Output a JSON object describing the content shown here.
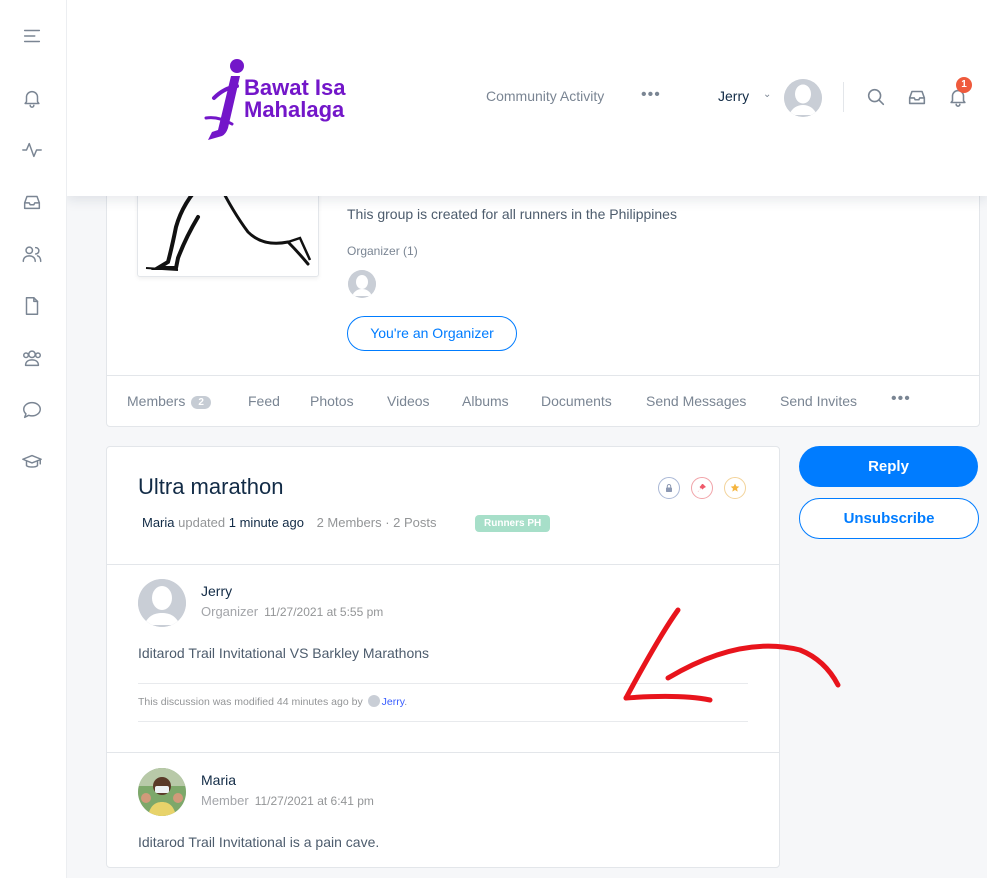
{
  "header": {
    "logo_line1": "Bawat Isa",
    "logo_line2": "Mahalaga",
    "nav_link": "Community Activity",
    "nav_more": "•••",
    "user_name": "Jerry",
    "user_chevron": "⌄",
    "notification_count": "1"
  },
  "sidebar": {
    "icons": [
      "menu-icon",
      "bell-icon",
      "activity-icon",
      "inbox-icon",
      "members-icon",
      "document-icon",
      "groups-icon",
      "forums-icon",
      "courses-icon"
    ]
  },
  "group": {
    "description": "This group is created for all runners in the Philippines",
    "organizer_label": "Organizer (1)",
    "organizer_button": "You're an Organizer",
    "tabs": [
      {
        "label": "Members",
        "badge": "2"
      },
      {
        "label": "Feed"
      },
      {
        "label": "Photos"
      },
      {
        "label": "Videos"
      },
      {
        "label": "Albums"
      },
      {
        "label": "Documents"
      },
      {
        "label": "Send Messages"
      },
      {
        "label": "Send Invites"
      }
    ],
    "tabs_more": "•••"
  },
  "topic": {
    "title": "Ultra marathon",
    "meta_user": "Maria",
    "meta_updated": "updated",
    "meta_time": "1 minute ago",
    "meta_counts": "2 Members · 2 Posts",
    "group_tag": "Runners PH",
    "replies": [
      {
        "name": "Jerry",
        "role": "Organizer",
        "timestamp": "11/27/2021 at 5:55 pm",
        "body": "Iditarod Trail Invitational VS Barkley Marathons"
      },
      {
        "name": "Maria",
        "role": "Member",
        "timestamp": "11/27/2021 at 6:41 pm",
        "body": "Iditarod Trail Invitational is a pain cave."
      }
    ],
    "modified_note_prefix": "This discussion was modified 44 minutes ago by",
    "modified_note_user": "Jerry",
    "modified_note_suffix": "."
  },
  "actions": {
    "reply_label": "Reply",
    "unsubscribe_label": "Unsubscribe"
  },
  "colors": {
    "accent": "#007cff",
    "logo_purple": "#7316c9",
    "badge_red": "#ef5a3c",
    "tag_green": "#a7dfc9",
    "annotation_red": "#e8141c"
  }
}
